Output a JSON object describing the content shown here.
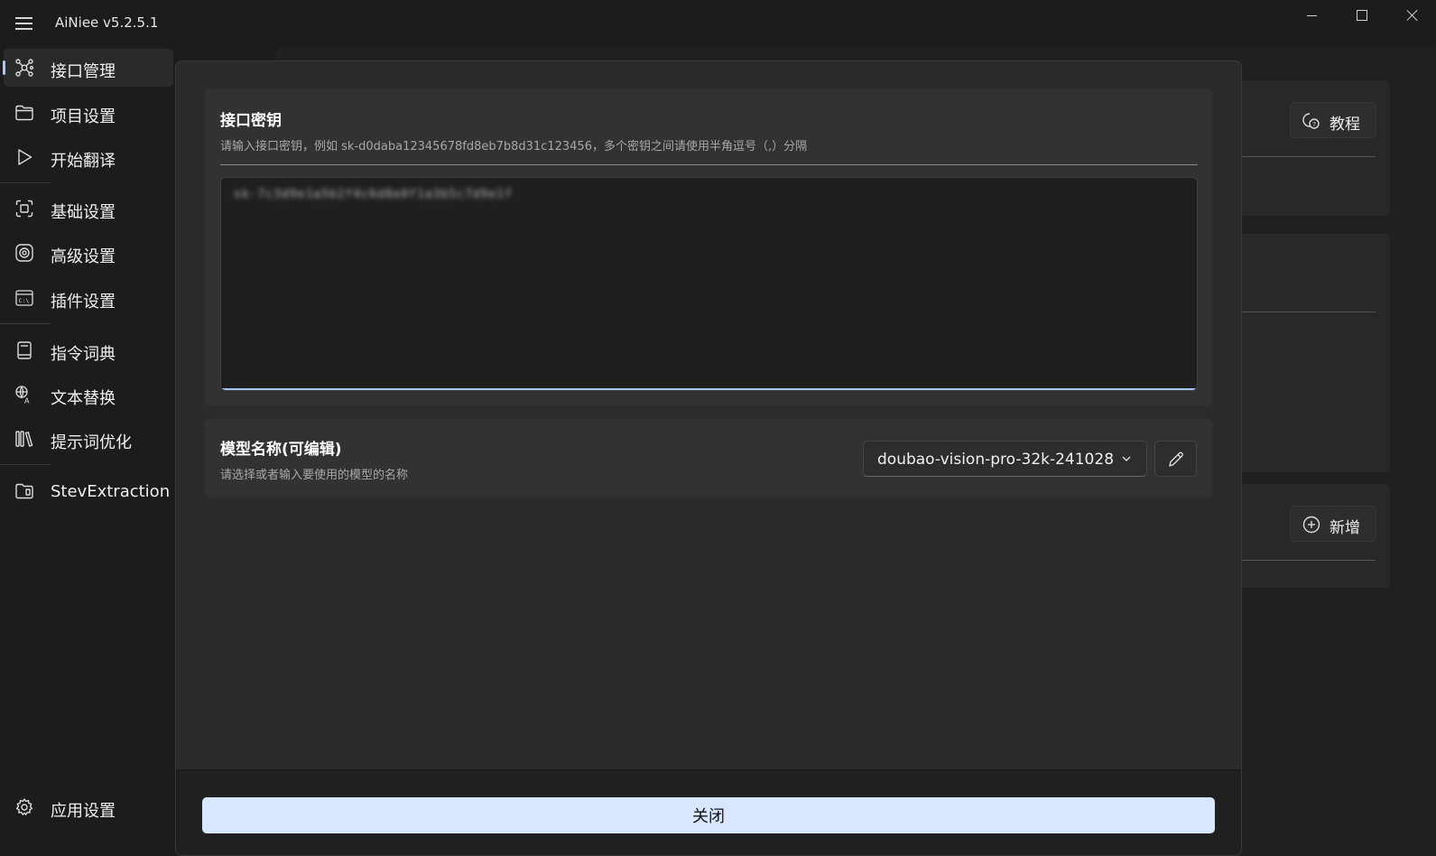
{
  "app": {
    "title": "AiNiee v5.2.5.1"
  },
  "sidebar": {
    "items": [
      {
        "label": "接口管理",
        "icon": "network-icon",
        "active": true
      },
      {
        "label": "项目设置",
        "icon": "folder-icon"
      },
      {
        "label": "开始翻译",
        "icon": "play-icon"
      },
      {
        "label": "基础设置",
        "icon": "frame-icon"
      },
      {
        "label": "高级设置",
        "icon": "target-icon"
      },
      {
        "label": "插件设置",
        "icon": "terminal-icon"
      },
      {
        "label": "指令词典",
        "icon": "book-icon"
      },
      {
        "label": "文本替换",
        "icon": "language-icon"
      },
      {
        "label": "提示词优化",
        "icon": "library-icon"
      },
      {
        "label": "StevExtraction",
        "icon": "extract-icon"
      }
    ],
    "footer_item": {
      "label": "应用设置",
      "icon": "gear-icon"
    }
  },
  "background": {
    "tutorial_label": "教程",
    "add_label": "新增"
  },
  "dialog": {
    "api_key": {
      "title": "接口密钥",
      "description": "请输入接口密钥，例如 sk-d0daba12345678fd8eb7b8d31c123456，多个密钥之间请使用半角逗号（,）分隔",
      "value": "sk-7c3d9e1a5b2f4c6d8e0f1a3b5c7d9e1f"
    },
    "model": {
      "title": "模型名称(可编辑)",
      "description": "请选择或者输入要使用的模型的名称",
      "selected": "doubao-vision-pro-32k-241028"
    },
    "close_label": "关闭"
  },
  "colors": {
    "accent": "#a6c8ff",
    "close_button_bg": "#d8e6ff",
    "dialog_bg": "#2b2b2b",
    "card_bg": "#323232"
  }
}
